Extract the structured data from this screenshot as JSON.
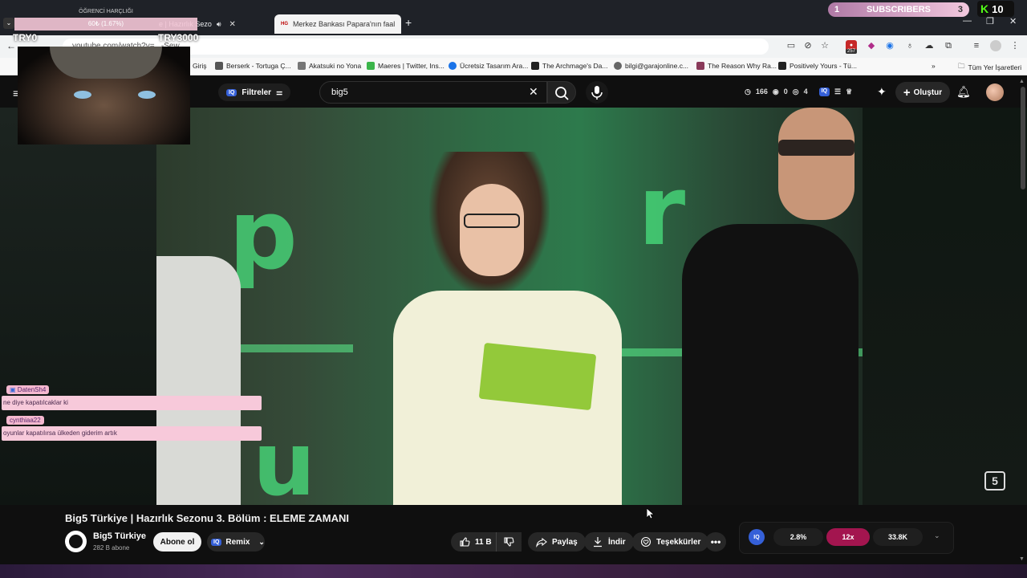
{
  "stream_overlay": {
    "goal_title": "ÖĞRENCİ HARÇLIĞI",
    "goal_progress_text": "60₺ (1.67%)",
    "goal_progress": 0.0167,
    "left_label": "TRY0",
    "right_label": "TRY3000",
    "subscribers_left": "1",
    "subscribers_label": "SUBSCRIBERS",
    "subscribers_right": "3",
    "kick_count": "10"
  },
  "browser": {
    "tabs": [
      {
        "label": "e | Hazırlık Sezo",
        "active": false
      },
      {
        "label": "Merkez Bankası Papara'nın faal",
        "active": true
      }
    ],
    "new_tab": "+",
    "url_text": "youtube.com/watch?v=...-Sew",
    "bookmarks": [
      {
        "label": "Giriş",
        "color": "#999999"
      },
      {
        "label": "Berserk - Tortuga Ç...",
        "color": "#555555"
      },
      {
        "label": "Akatsuki no Yona",
        "color": "#777777"
      },
      {
        "label": "Maeres | Twitter, Ins...",
        "color": "#3bb54a"
      },
      {
        "label": "Ücretsiz Tasarım Ara...",
        "color": "#1a73e8"
      },
      {
        "label": "The Archmage's Da...",
        "color": "#222222"
      },
      {
        "label": "bilgi@garajonline.c...",
        "color": "#666666"
      },
      {
        "label": "The Reason Why Ra...",
        "color": "#8a3a5a"
      },
      {
        "label": "Positively Yours - Tü...",
        "color": "#222222"
      }
    ],
    "all_bookmarks": "Tüm Yer İşaretleri",
    "extension_badge": "257"
  },
  "header": {
    "filters_label": "Filtreler",
    "iq_label": "IQ",
    "search_value": "big5",
    "stats": {
      "clock": "166",
      "eye": "0",
      "view": "4"
    },
    "create_label": "Oluştur"
  },
  "chat": [
    {
      "user": "DatenSh4",
      "message": "ne diye kapatılcaklar ki"
    },
    {
      "user": "cynthiaa22",
      "message": "oyunlar kapatılırsa ülkeden giderim artık"
    }
  ],
  "video": {
    "title": "Big5 Türkiye | Hazırlık Sezonu 3. Bölüm : ELEME ZAMANI",
    "channel_name": "Big5 Türkiye",
    "channel_subs": "282 B abone",
    "subscribe_label": "Abone ol",
    "remix_label": "Remix",
    "like_count": "11 B",
    "share_label": "Paylaş",
    "download_label": "İndir",
    "thanks_label": "Teşekkürler"
  },
  "extension_panel": {
    "iq_label": "IQ",
    "percent": "2.8%",
    "multiplier": "12x",
    "count": "33.8K"
  }
}
